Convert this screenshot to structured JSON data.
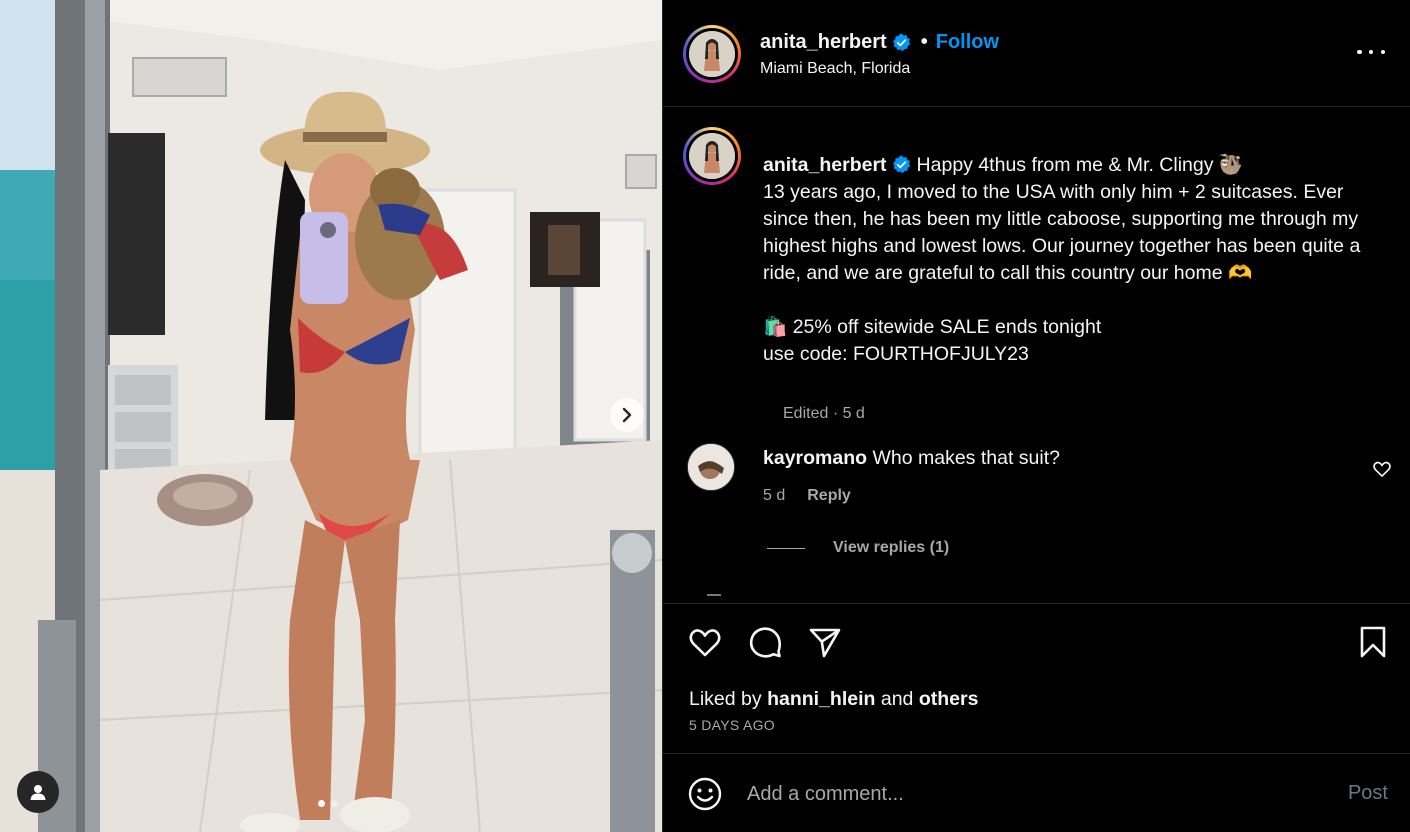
{
  "post": {
    "username": "anita_herbert",
    "follow_label": "Follow",
    "separator": "•",
    "location": "Miami Beach, Florida",
    "verified": true
  },
  "caption": {
    "username": "anita_herbert",
    "text": "Happy 4thus from me & Mr. Clingy 🦥\n13 years ago, I moved to the USA with only him + 2 suitcases. Ever since then, he has been my little caboose, supporting me through my highest highs and lowest lows. Our journey together has been quite a ride, and we are grateful to call this country our home 🫶\n\n🛍️ 25% off sitewide SALE ends tonight\nuse code: FOURTHOFJULY23",
    "meta": "Edited · 5 d"
  },
  "comments": [
    {
      "username": "kayromano",
      "text": "Who makes that suit?",
      "age": "5 d",
      "reply_label": "Reply",
      "view_replies": "View replies (1)"
    }
  ],
  "likes": {
    "prefix": "Liked by",
    "user": "hanni_hlein",
    "joiner": "and",
    "others": "others",
    "date": "5 DAYS AGO"
  },
  "composer": {
    "placeholder": "Add a comment...",
    "post_label": "Post"
  },
  "carousel": {
    "slide_count": 2,
    "active_index": 0
  },
  "icons": {
    "verified": "verified-badge-icon",
    "more": "more-options-icon",
    "like": "heart-icon",
    "comment": "comment-bubble-icon",
    "share": "paper-plane-icon",
    "save": "bookmark-icon",
    "emoji": "emoji-smile-icon",
    "next": "chevron-right-icon",
    "user_tag": "user-tag-icon"
  },
  "colors": {
    "background": "#000000",
    "text": "#f5f5f5",
    "secondary": "#a8a8a8",
    "link": "#0095f6",
    "verified": "#0095f6",
    "divider": "#262626"
  }
}
